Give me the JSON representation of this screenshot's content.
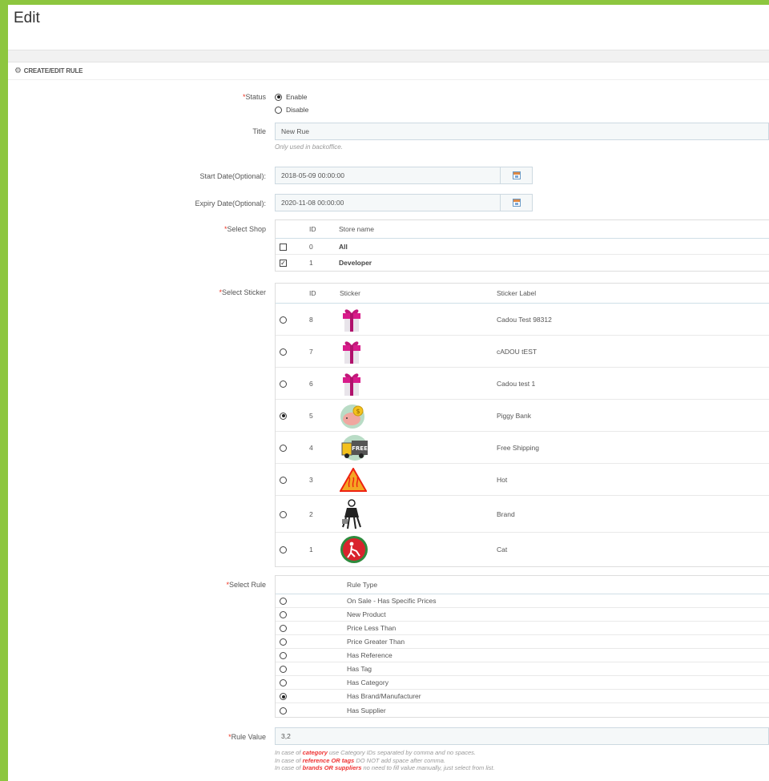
{
  "page": {
    "title": "Edit"
  },
  "panel": {
    "heading": "CREATE/EDIT RULE",
    "icon": "cogs-icon"
  },
  "status": {
    "label": "Status",
    "options": [
      {
        "label": "Enable",
        "selected": true
      },
      {
        "label": "Disable",
        "selected": false
      }
    ]
  },
  "title_field": {
    "label": "Title",
    "value": "New Rue",
    "help": "Only used in backoffice."
  },
  "start_date": {
    "label": "Start Date(Optional):",
    "value": "2018-05-09 00:00:00"
  },
  "expiry_date": {
    "label": "Expiry Date(Optional):",
    "value": "2020-11-08 00:00:00"
  },
  "shop": {
    "label": "Select Shop",
    "columns": [
      "ID",
      "Store name"
    ],
    "rows": [
      {
        "id": "0",
        "name": "All",
        "checked": false
      },
      {
        "id": "1",
        "name": "Developer",
        "checked": true
      }
    ]
  },
  "sticker": {
    "label": "Select Sticker",
    "columns": [
      "ID",
      "Sticker",
      "Sticker Label"
    ],
    "rows": [
      {
        "id": "8",
        "icon": "gift-icon",
        "label": "Cadou Test 98312",
        "selected": false
      },
      {
        "id": "7",
        "icon": "gift-icon",
        "label": "cADOU tEST",
        "selected": false
      },
      {
        "id": "6",
        "icon": "gift-icon",
        "label": "Cadou test 1",
        "selected": false
      },
      {
        "id": "5",
        "icon": "piggy-bank-icon",
        "label": "Piggy Bank",
        "selected": true
      },
      {
        "id": "4",
        "icon": "free-shipping-truck-icon",
        "label": "Free Shipping",
        "selected": false
      },
      {
        "id": "3",
        "icon": "hot-warning-icon",
        "label": "Hot",
        "selected": false
      },
      {
        "id": "2",
        "icon": "brand-figure-icon",
        "label": "Brand",
        "selected": false
      },
      {
        "id": "1",
        "icon": "cat-sign-icon",
        "label": "Cat",
        "selected": false
      }
    ]
  },
  "rule": {
    "label": "Select Rule",
    "column": "Rule Type",
    "rows": [
      {
        "label": "On Sale - Has Specific Prices",
        "selected": false
      },
      {
        "label": "New Product",
        "selected": false
      },
      {
        "label": "Price Less Than",
        "selected": false
      },
      {
        "label": "Price Greater Than",
        "selected": false
      },
      {
        "label": "Has Reference",
        "selected": false
      },
      {
        "label": "Has Tag",
        "selected": false
      },
      {
        "label": "Has Category",
        "selected": false
      },
      {
        "label": "Has Brand/Manufacturer",
        "selected": true
      },
      {
        "label": "Has Supplier",
        "selected": false
      }
    ]
  },
  "rule_value": {
    "label": "Rule Value",
    "value": "3,2",
    "help": [
      {
        "pre": "In case of ",
        "key": "category",
        "post": " use Category IDs separated by comma and no spaces."
      },
      {
        "pre": "In case of ",
        "key": "reference OR tags",
        "post": " DO NOT add space after comma."
      },
      {
        "pre": "In case of ",
        "key": "brands OR suppliers",
        "post": " no need to fill value manually, just select from list."
      }
    ]
  },
  "colors": {
    "frame": "#8dc63f",
    "required": "#ee3322",
    "input_bg": "#f5f8f9"
  }
}
